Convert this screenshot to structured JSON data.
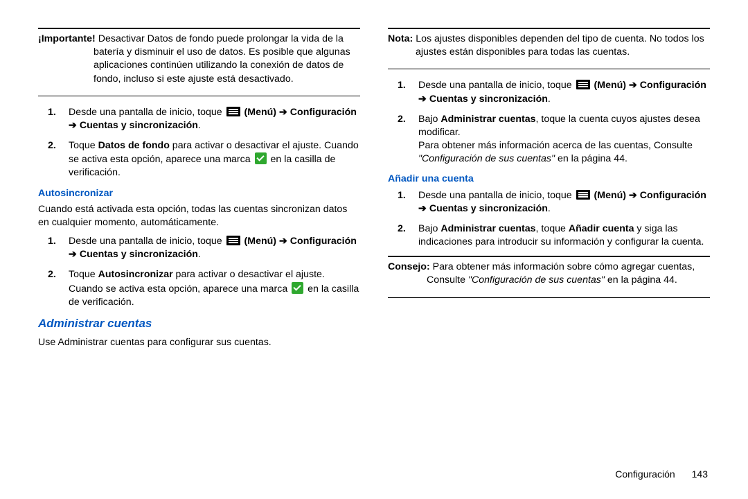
{
  "col1": {
    "important": {
      "label": "¡Importante!",
      "text": "Desactivar Datos de fondo puede prolongar la vida de la batería y disminuir el uso de datos. Es posible que algunas aplicaciones continúen utilizando la conexión de datos de fondo, incluso si este ajuste está desactivado."
    },
    "stepsA": {
      "num1": "1.",
      "s1_a": "Desde una pantalla de inicio, toque ",
      "s1_b": " (Menú) ➔ Configuración ➔ Cuentas y sincronización",
      "s1_c": ".",
      "num2": "2.",
      "s2_a": "Toque ",
      "s2_b": "Datos de fondo",
      "s2_c": " para activar o desactivar el ajuste. Cuando se activa esta opción, aparece una marca ",
      "s2_d": " en la casilla de verificación."
    },
    "h3_autosync": "Autosincronizar",
    "p_autosync": "Cuando está activada esta opción, todas las cuentas sincronizan datos en cualquier momento, automáticamente.",
    "stepsB": {
      "num1": "1.",
      "s1_a": "Desde una pantalla de inicio, toque ",
      "s1_b": " (Menú) ➔ Configuración ➔ Cuentas y sincronización",
      "s1_c": ".",
      "num2": "2.",
      "s2_a": "Toque ",
      "s2_b": "Autosincronizar",
      "s2_c": " para activar o desactivar el ajuste. Cuando se activa esta opción, aparece una marca ",
      "s2_d": " en la casilla de verificación."
    },
    "h2_admin": "Administrar cuentas",
    "p_admin": "Use Administrar cuentas para configurar sus cuentas."
  },
  "col2": {
    "nota": {
      "label": "Nota:",
      "text": "Los ajustes disponibles dependen del tipo de cuenta. No todos los ajustes están disponibles para todas las cuentas."
    },
    "stepsC": {
      "num1": "1.",
      "s1_a": "Desde una pantalla de inicio, toque ",
      "s1_b": " (Menú) ➔ Configuración ➔ Cuentas y sincronización",
      "s1_c": ".",
      "num2": "2.",
      "s2_a": "Bajo ",
      "s2_b": "Administrar cuentas",
      "s2_c": ", toque la cuenta cuyos ajustes desea modificar.",
      "s2_d": "Para obtener más información acerca de las cuentas, Consulte ",
      "s2_e": "\"Configuración de sus cuentas\"",
      "s2_f": " en la página 44."
    },
    "h3_add": "Añadir una cuenta",
    "stepsD": {
      "num1": "1.",
      "s1_a": "Desde una pantalla de inicio, toque ",
      "s1_b": " (Menú) ➔ Configuración ➔ Cuentas y sincronización",
      "s1_c": ".",
      "num2": "2.",
      "s2_a": "Bajo ",
      "s2_b": "Administrar cuentas",
      "s2_c": ", toque ",
      "s2_d": "Añadir cuenta",
      "s2_e": " y siga las indicaciones para introducir su información y configurar la cuenta."
    },
    "consejo": {
      "label": "Consejo:",
      "a": "Para obtener más información sobre cómo agregar cuentas, Consulte ",
      "b": "\"Configuración de sus cuentas\"",
      "c": " en la página 44."
    }
  },
  "footer": {
    "section": "Configuración",
    "page": "143"
  }
}
